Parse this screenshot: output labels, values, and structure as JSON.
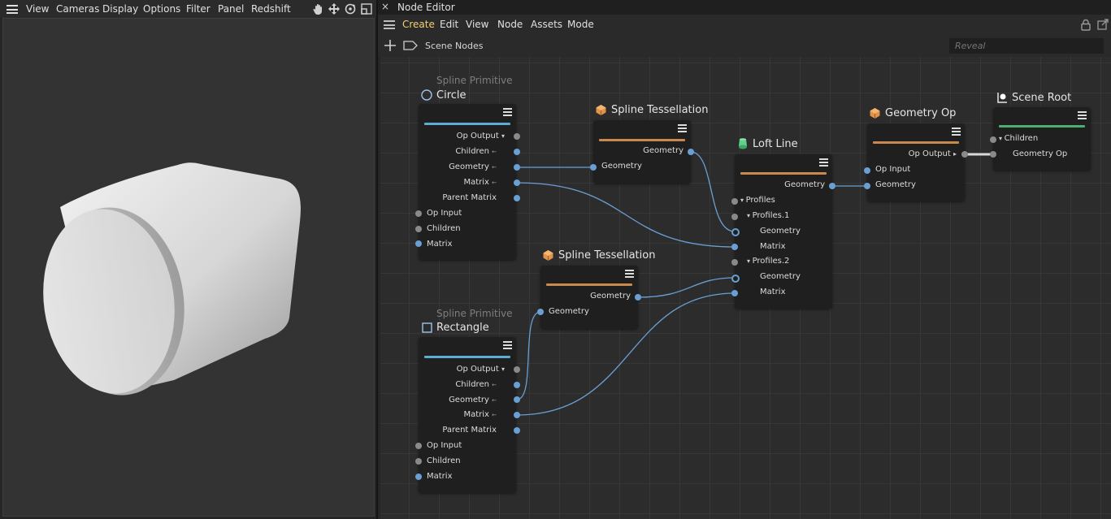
{
  "viewport": {
    "menu": [
      "View",
      "Cameras",
      "Display",
      "Options",
      "Filter",
      "Panel",
      "Redshift"
    ],
    "tools": [
      "hand-pan-icon",
      "move-arrows-icon",
      "rotate-orbit-icon",
      "maximize-panel-icon"
    ]
  },
  "node_editor": {
    "title": "Node Editor",
    "close_glyph": "×",
    "menu": [
      "Create",
      "Edit",
      "View",
      "Node",
      "Assets",
      "Mode"
    ],
    "breadcrumb": "Scene Nodes",
    "search_placeholder": "Reveal",
    "nodes": {
      "circle": {
        "subtitle": "Spline Primitive",
        "title": "Circle",
        "outputs": [
          "Op Output",
          "Children",
          "Geometry",
          "Matrix",
          "Parent Matrix"
        ],
        "inputs": [
          "Op Input",
          "Children",
          "Matrix"
        ]
      },
      "rectangle": {
        "subtitle": "Spline Primitive",
        "title": "Rectangle",
        "outputs": [
          "Op Output",
          "Children",
          "Geometry",
          "Matrix",
          "Parent Matrix"
        ],
        "inputs": [
          "Op Input",
          "Children",
          "Matrix"
        ]
      },
      "tess1": {
        "title": "Spline Tessellation",
        "output": "Geometry",
        "input": "Geometry"
      },
      "tess2": {
        "title": "Spline Tessellation",
        "output": "Geometry",
        "input": "Geometry"
      },
      "loft": {
        "title": "Loft Line",
        "output": "Geometry",
        "inputs": [
          "Profiles",
          "Profiles.1",
          "Geometry",
          "Matrix",
          "Profiles.2",
          "Geometry",
          "Matrix"
        ]
      },
      "geomop": {
        "title": "Geometry Op",
        "output": "Op Output",
        "inputs": [
          "Op Input",
          "Geometry"
        ]
      },
      "sceneroot": {
        "title": "Scene Root",
        "inputs": [
          "Children",
          "Geometry Op"
        ]
      }
    }
  },
  "colors": {
    "spline_bar": "#5aaed0",
    "tess_bar": "#c8884e",
    "root_bar": "#4cae6e",
    "port_blue": "#6a9fd4",
    "wire": "#6a9fd4",
    "active_menu": "#f0d26e"
  }
}
